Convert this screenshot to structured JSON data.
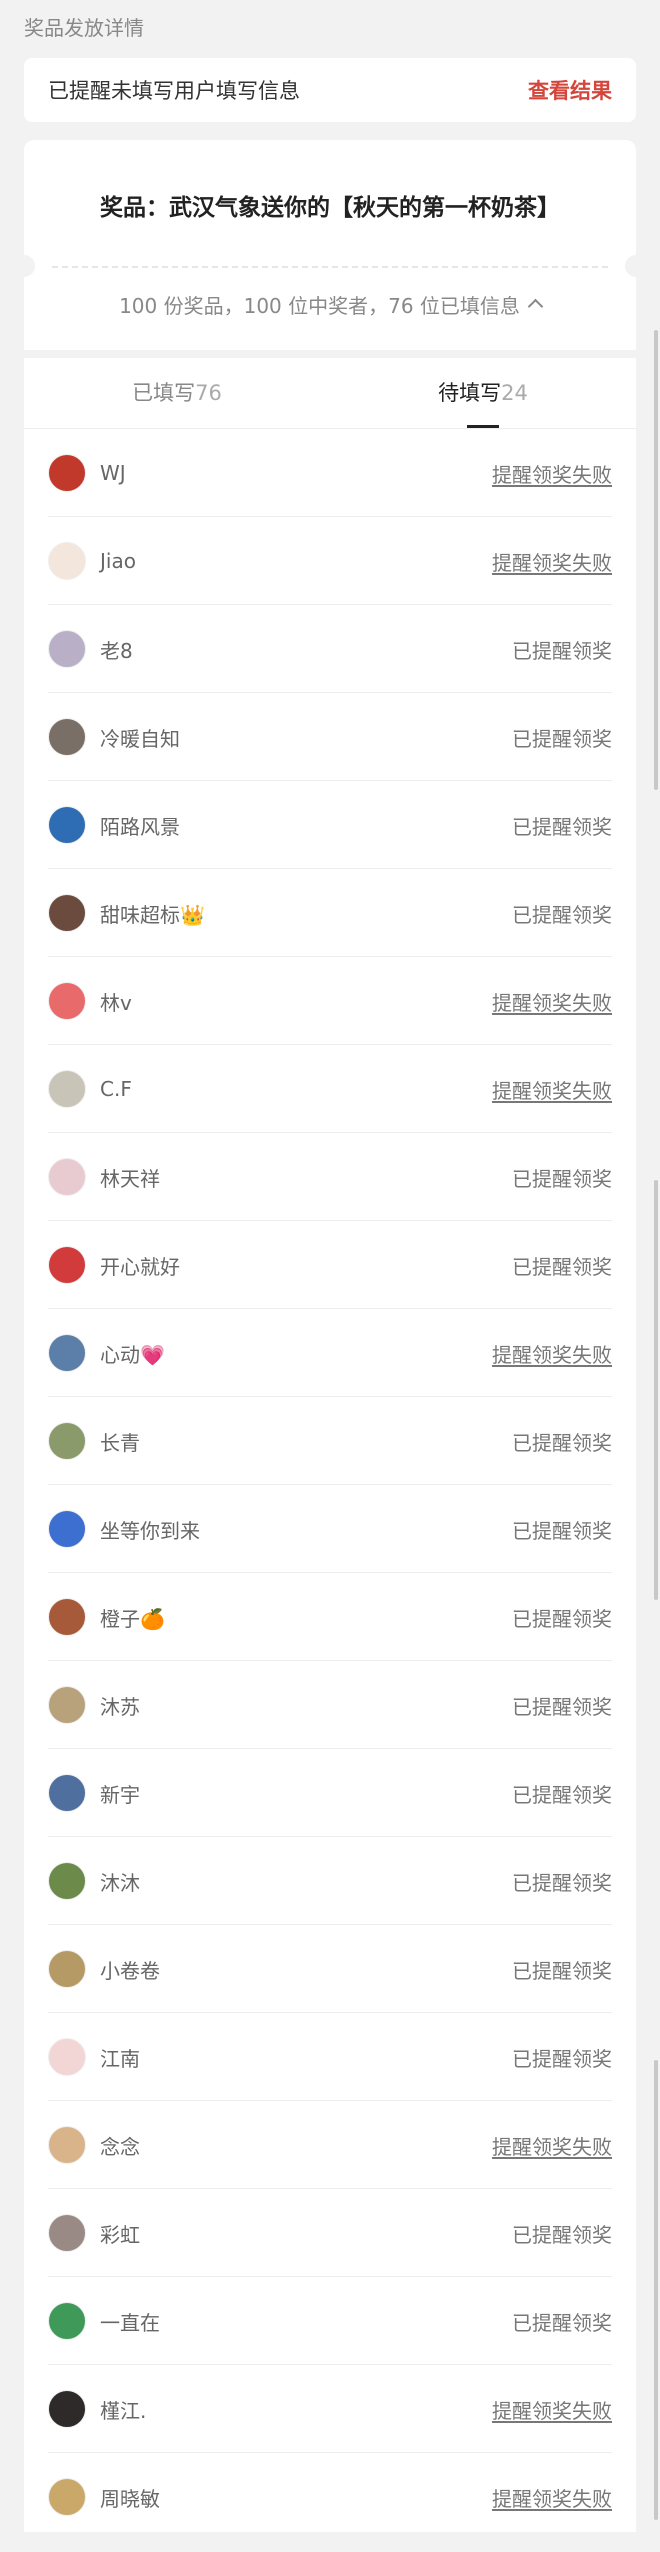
{
  "header": {
    "section_title": "奖品发放详情"
  },
  "reminder": {
    "message": "已提醒未填写用户填写信息",
    "link": "查看结果"
  },
  "prize": {
    "title": "奖品：武汉气象送你的【秋天的第一杯奶茶】",
    "summary": "100 份奖品，100 位中奖者，76 位已填信息"
  },
  "tabs": [
    {
      "label": "已填写",
      "count": "76",
      "active": false
    },
    {
      "label": "待填写",
      "count": "24",
      "active": true
    }
  ],
  "status_labels": {
    "reminded": "已提醒领奖",
    "failed": "提醒领奖失败"
  },
  "winners": [
    {
      "name": "WJ",
      "status": "提醒领奖失败",
      "failed": true,
      "avatar_color": "#c0392b"
    },
    {
      "name": "Jiao",
      "status": "提醒领奖失败",
      "failed": true,
      "avatar_color": "#f3e6dc"
    },
    {
      "name": "老8",
      "status": "已提醒领奖",
      "failed": false,
      "avatar_color": "#b9b0c8"
    },
    {
      "name": "冷暖自知",
      "status": "已提醒领奖",
      "failed": false,
      "avatar_color": "#7a6f66"
    },
    {
      "name": "陌路风景",
      "status": "已提醒领奖",
      "failed": false,
      "avatar_color": "#2e6db3"
    },
    {
      "name": "甜味超标👑",
      "status": "已提醒领奖",
      "failed": false,
      "avatar_color": "#6b4b3e"
    },
    {
      "name": "林v",
      "status": "提醒领奖失败",
      "failed": true,
      "avatar_color": "#e86a6a"
    },
    {
      "name": "C.F",
      "status": "提醒领奖失败",
      "failed": true,
      "avatar_color": "#c9c4b8"
    },
    {
      "name": "林天祥",
      "status": "已提醒领奖",
      "failed": false,
      "avatar_color": "#e8cbd0"
    },
    {
      "name": "开心就好",
      "status": "已提醒领奖",
      "failed": false,
      "avatar_color": "#d23b3b"
    },
    {
      "name": "心动💗",
      "status": "提醒领奖失败",
      "failed": true,
      "avatar_color": "#5b7fa8"
    },
    {
      "name": "长青",
      "status": "已提醒领奖",
      "failed": false,
      "avatar_color": "#8a9a6a"
    },
    {
      "name": "坐等你到来",
      "status": "已提醒领奖",
      "failed": false,
      "avatar_color": "#3d6fd0"
    },
    {
      "name": "橙子🍊",
      "status": "已提醒领奖",
      "failed": false,
      "avatar_color": "#a65a3a"
    },
    {
      "name": "沐苏",
      "status": "已提醒领奖",
      "failed": false,
      "avatar_color": "#b8a27c"
    },
    {
      "name": "新宇",
      "status": "已提醒领奖",
      "failed": false,
      "avatar_color": "#4f6f9f"
    },
    {
      "name": "沐沐",
      "status": "已提醒领奖",
      "failed": false,
      "avatar_color": "#6c8a4a"
    },
    {
      "name": "小卷卷",
      "status": "已提醒领奖",
      "failed": false,
      "avatar_color": "#b59a66"
    },
    {
      "name": "江南",
      "status": "已提醒领奖",
      "failed": false,
      "avatar_color": "#f2d6d6"
    },
    {
      "name": "念念",
      "status": "提醒领奖失败",
      "failed": true,
      "avatar_color": "#d9b48a"
    },
    {
      "name": "彩虹",
      "status": "已提醒领奖",
      "failed": false,
      "avatar_color": "#9a8a86"
    },
    {
      "name": "一直在",
      "status": "已提醒领奖",
      "failed": false,
      "avatar_color": "#3f9a5a"
    },
    {
      "name": "槿江.",
      "status": "提醒领奖失败",
      "failed": true,
      "avatar_color": "#2f2a2a"
    },
    {
      "name": "周晓敏",
      "status": "提醒领奖失败",
      "failed": true,
      "avatar_color": "#c9a86a"
    }
  ]
}
